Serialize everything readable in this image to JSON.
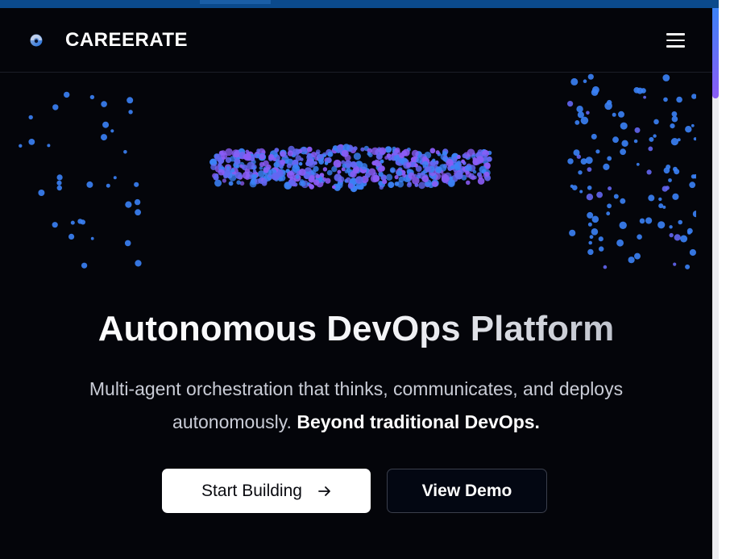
{
  "app": {
    "brand": "CAREERATE",
    "logo_icon": "careerate-logo-icon",
    "menu_icon": "hamburger-menu-icon"
  },
  "hero": {
    "title": "Autonomous DevOps Platform",
    "subtitle_line1": "Multi-agent orchestration that thinks, communicates, and deploys",
    "subtitle_line2": "autonomously.",
    "subtitle_emphasis": "Beyond traditional DevOps.",
    "particle_colors": [
      "#3b82f6",
      "#6366f1",
      "#8b5cf6"
    ]
  },
  "actions": {
    "primary_label": "Start Building",
    "primary_icon": "arrow-right-icon",
    "secondary_label": "View Demo"
  },
  "colors": {
    "background": "#04050a",
    "accent_blue": "#3b82f6",
    "accent_purple": "#8b5cf6",
    "browser_chrome": "#0b4a8c"
  }
}
